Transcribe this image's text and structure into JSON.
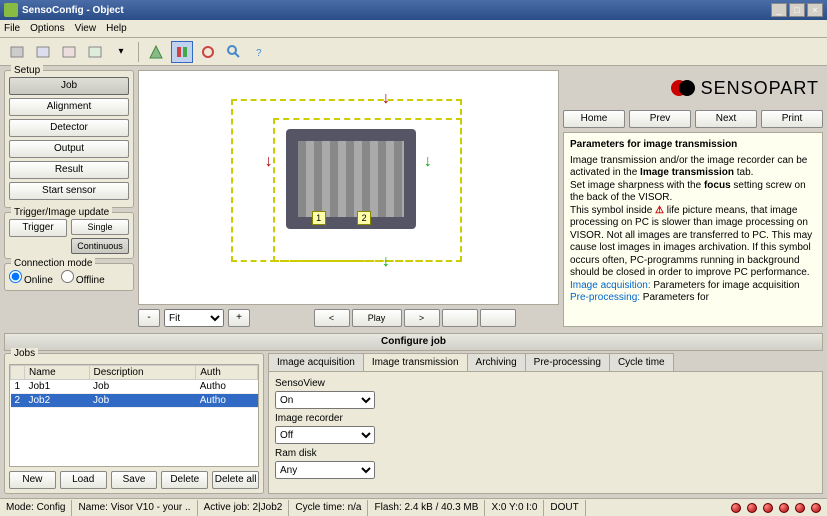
{
  "window": {
    "title": "SensoConfig - Object"
  },
  "menu": {
    "file": "File",
    "options": "Options",
    "view": "View",
    "help": "Help"
  },
  "setup": {
    "legend": "Setup",
    "job": "Job",
    "alignment": "Alignment",
    "detector": "Detector",
    "output": "Output",
    "result": "Result",
    "start": "Start sensor"
  },
  "trigger": {
    "legend": "Trigger/Image update",
    "trigger": "Trigger",
    "single": "Single",
    "continuous": "Continuous"
  },
  "connection": {
    "legend": "Connection mode",
    "online": "Online",
    "offline": "Offline"
  },
  "zoom": {
    "minus": "-",
    "plus": "+",
    "fit": "Fit"
  },
  "play": {
    "prev": "<",
    "play": "Play",
    "next": ">"
  },
  "brand": {
    "name": "SENSOPART"
  },
  "nav": {
    "home": "Home",
    "prev": "Prev",
    "next": "Next",
    "print": "Print"
  },
  "help": {
    "title": "Parameters for image transmission",
    "p1a": "Image transmission and/or the image recorder can be activated in the ",
    "p1b": "Image transmission",
    "p1c": " tab.",
    "p2a": "Set image sharpness with the ",
    "p2b": "focus",
    "p2c": " setting screw on the back of the VISOR.",
    "p3a": "This symbol inside ",
    "p3b": " life picture means, that image processing on PC is slower than image processing on VISOR. Not all images are transferred to PC. This may cause lost images in images archivation. If this symbol occurs often, PC-programms running in background should be closed in order to improve PC performance.",
    "link1": "Image acquisition:",
    "link1t": " Parameters for image acquisition",
    "link2": "Pre-processing:",
    "link2t": " Parameters for"
  },
  "section": {
    "configure": "Configure job"
  },
  "jobs": {
    "legend": "Jobs",
    "cols": {
      "name": "Name",
      "desc": "Description",
      "auth": "Auth"
    },
    "rows": [
      {
        "n": "1",
        "name": "Job1",
        "desc": "Job",
        "auth": "Autho"
      },
      {
        "n": "2",
        "name": "Job2",
        "desc": "Job",
        "auth": "Autho"
      }
    ],
    "btns": {
      "new": "New",
      "load": "Load",
      "save": "Save",
      "delete": "Delete",
      "deleteall": "Delete all"
    }
  },
  "tabs": {
    "acq": "Image acquisition",
    "trans": "Image transmission",
    "arch": "Archiving",
    "pre": "Pre-processing",
    "cycle": "Cycle time"
  },
  "form": {
    "sensoview_lbl": "SensoView",
    "sensoview_val": "On",
    "recorder_lbl": "Image recorder",
    "recorder_val": "Off",
    "ramdisk_lbl": "Ram disk",
    "ramdisk_val": "Any"
  },
  "status": {
    "mode_l": "Mode:",
    "mode_v": "Config",
    "name_l": "Name:",
    "name_v": "Visor V10 - your ..",
    "job_l": "Active job:",
    "job_v": "2|Job2",
    "cycle_l": "Cycle time:",
    "cycle_v": "n/a",
    "flash_l": "Flash:",
    "flash_v": "2.4 kB / 40.3 MB",
    "xy": "X:0 Y:0 I:0",
    "dout": "DOUT"
  }
}
